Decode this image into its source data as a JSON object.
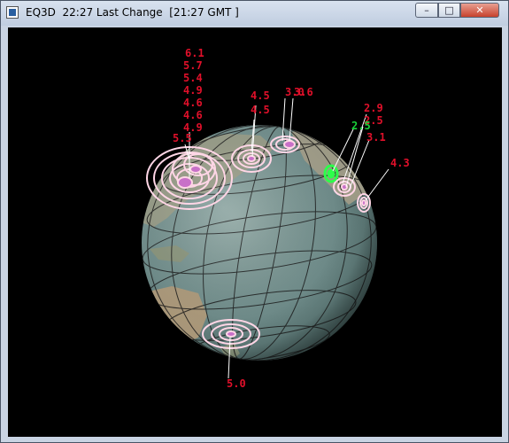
{
  "window": {
    "title": "EQ3D  22:27 Last Change  [21:27 GMT ]",
    "minimize_label": "–",
    "maximize_label": "□",
    "close_label": "✕"
  },
  "quakes": [
    {
      "id": "q1",
      "mag": "6.1"
    },
    {
      "id": "q2",
      "mag": "5.7"
    },
    {
      "id": "q3",
      "mag": "5.4"
    },
    {
      "id": "q4",
      "mag": "4.9"
    },
    {
      "id": "q5",
      "mag": "4.6"
    },
    {
      "id": "q6",
      "mag": "4.6"
    },
    {
      "id": "q7",
      "mag": "4.9"
    },
    {
      "id": "q8",
      "mag": "5.5"
    },
    {
      "id": "q9",
      "mag": "4.5"
    },
    {
      "id": "q10",
      "mag": "4.5"
    },
    {
      "id": "q11",
      "mag": "3.0"
    },
    {
      "id": "q12",
      "mag": "3.6"
    },
    {
      "id": "q13",
      "mag": "2.9"
    },
    {
      "id": "q14",
      "mag": "2.5"
    },
    {
      "id": "q15",
      "mag": "2.5"
    },
    {
      "id": "q16",
      "mag": "3.1"
    },
    {
      "id": "q17",
      "mag": "4.3"
    },
    {
      "id": "q18",
      "mag": "5.0"
    }
  ],
  "colors": {
    "label_red": "#e0102a",
    "label_green": "#19d43a",
    "ring_pink": "#ffd6e6",
    "ring_green": "#2cff4a",
    "globe_ocean": "#6f8c8a"
  }
}
